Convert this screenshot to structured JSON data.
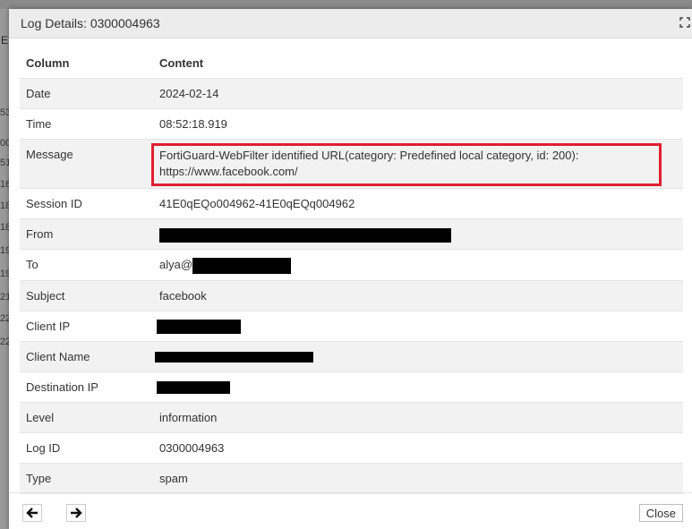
{
  "background": {
    "letter": "E",
    "row_numbers": [
      "53",
      "00",
      "51",
      "16",
      "18",
      "18",
      "19",
      "19",
      "21",
      "22",
      "22"
    ]
  },
  "dialog": {
    "title": "Log Details: 0300004963",
    "columns": {
      "col1": "Column",
      "col2": "Content"
    },
    "rows": [
      {
        "label": "Date",
        "value": "2024-02-14"
      },
      {
        "label": "Time",
        "value": "08:52:18.919"
      },
      {
        "label": "Message",
        "value": "FortiGuard-WebFilter identified URL(category: Predefined local category, id: 200): https://www.facebook.com/"
      },
      {
        "label": "Session ID",
        "value": "41E0qEQo004962-41E0qEQq004962"
      },
      {
        "label": "From",
        "value": ""
      },
      {
        "label": "To",
        "value": "alya@"
      },
      {
        "label": "Subject",
        "value": "facebook"
      },
      {
        "label": "Client IP",
        "value": ""
      },
      {
        "label": "Client Name",
        "value": ""
      },
      {
        "label": "Destination IP",
        "value": ""
      },
      {
        "label": "Level",
        "value": "information"
      },
      {
        "label": "Log ID",
        "value": "0300004963"
      },
      {
        "label": "Type",
        "value": "spam"
      }
    ],
    "footer": {
      "close_label": "Close"
    }
  },
  "colors": {
    "highlight": "#e02030",
    "redaction": "#000000"
  }
}
